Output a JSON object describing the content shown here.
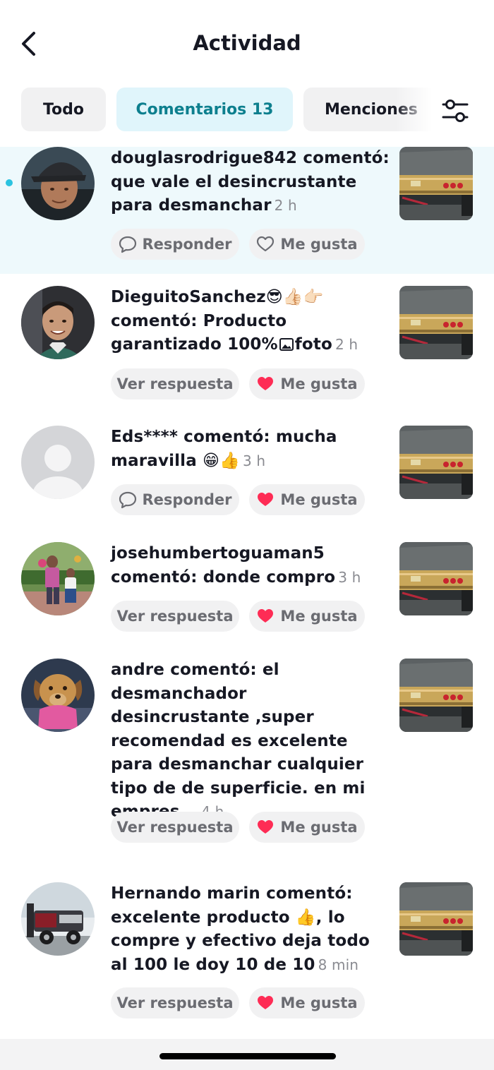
{
  "header": {
    "title": "Actividad"
  },
  "tabs": [
    {
      "label": "Todo",
      "active": false
    },
    {
      "label": "Comentarios 13",
      "active": true
    },
    {
      "label": "Menciones",
      "active": false
    }
  ],
  "colors": {
    "accent_tab_bg": "#e0f5fb",
    "accent_tab_text": "#0d7f8e",
    "unread_bg": "#eef9fc",
    "unread_dot": "#2bc3e0",
    "heart": "#fe2c55"
  },
  "icons": {
    "back": "chevron-left-icon",
    "filter": "sliders-icon",
    "reply": "speech-bubble-icon",
    "like_outline": "heart-outline-icon",
    "like_filled": "heart-filled-icon",
    "photo": "image-icon"
  },
  "comments": [
    {
      "unread": true,
      "user": "douglasrodrigue842",
      "text": "douglasrodrigue842 comentó: que vale el desincrustante para desmanchar",
      "time": "2 h",
      "action_label": "Responder",
      "like_label": "Me gusta",
      "liked": false
    },
    {
      "unread": false,
      "user": "DieguitoSanchez",
      "text_pre": "DieguitoSanchez",
      "emojis": "😎👍🏻👉🏻",
      "text_post": "comentó: Producto garantizado 100%",
      "photo_label": "foto",
      "time": "2 h",
      "action_label": "Ver respuesta",
      "like_label": "Me gusta",
      "liked": true
    },
    {
      "unread": false,
      "user": "Eds****",
      "text": "Eds**** comentó: mucha maravilla",
      "emojis": "😁👍",
      "time": "3 h",
      "action_label": "Responder",
      "like_label": "Me gusta",
      "liked": true
    },
    {
      "unread": false,
      "user": "josehumbertoguaman5",
      "text": "josehumbertoguaman5 comentó: donde compro",
      "time": "3 h",
      "action_label": "Ver respuesta",
      "like_label": "Me gusta",
      "liked": true
    },
    {
      "unread": false,
      "user": "andre",
      "text": "andre comentó: el desmanchador desincrustante ,super recomendad es excelente para desmanchar cualquier tipo de de superficie. en mi empres...",
      "time": "4 h",
      "action_label": "Ver respuesta",
      "like_label": "Me gusta",
      "liked": true
    },
    {
      "unread": false,
      "user": "Hernando marin",
      "text_pre": "Hernando marin comentó: excelente producto",
      "emojis": "👍",
      "text_post": ", lo compre y efectivo deja todo al 100 le doy 10 de 10",
      "time": "8 min",
      "action_label": "Ver respuesta",
      "like_label": "Me gusta",
      "liked": true
    }
  ]
}
